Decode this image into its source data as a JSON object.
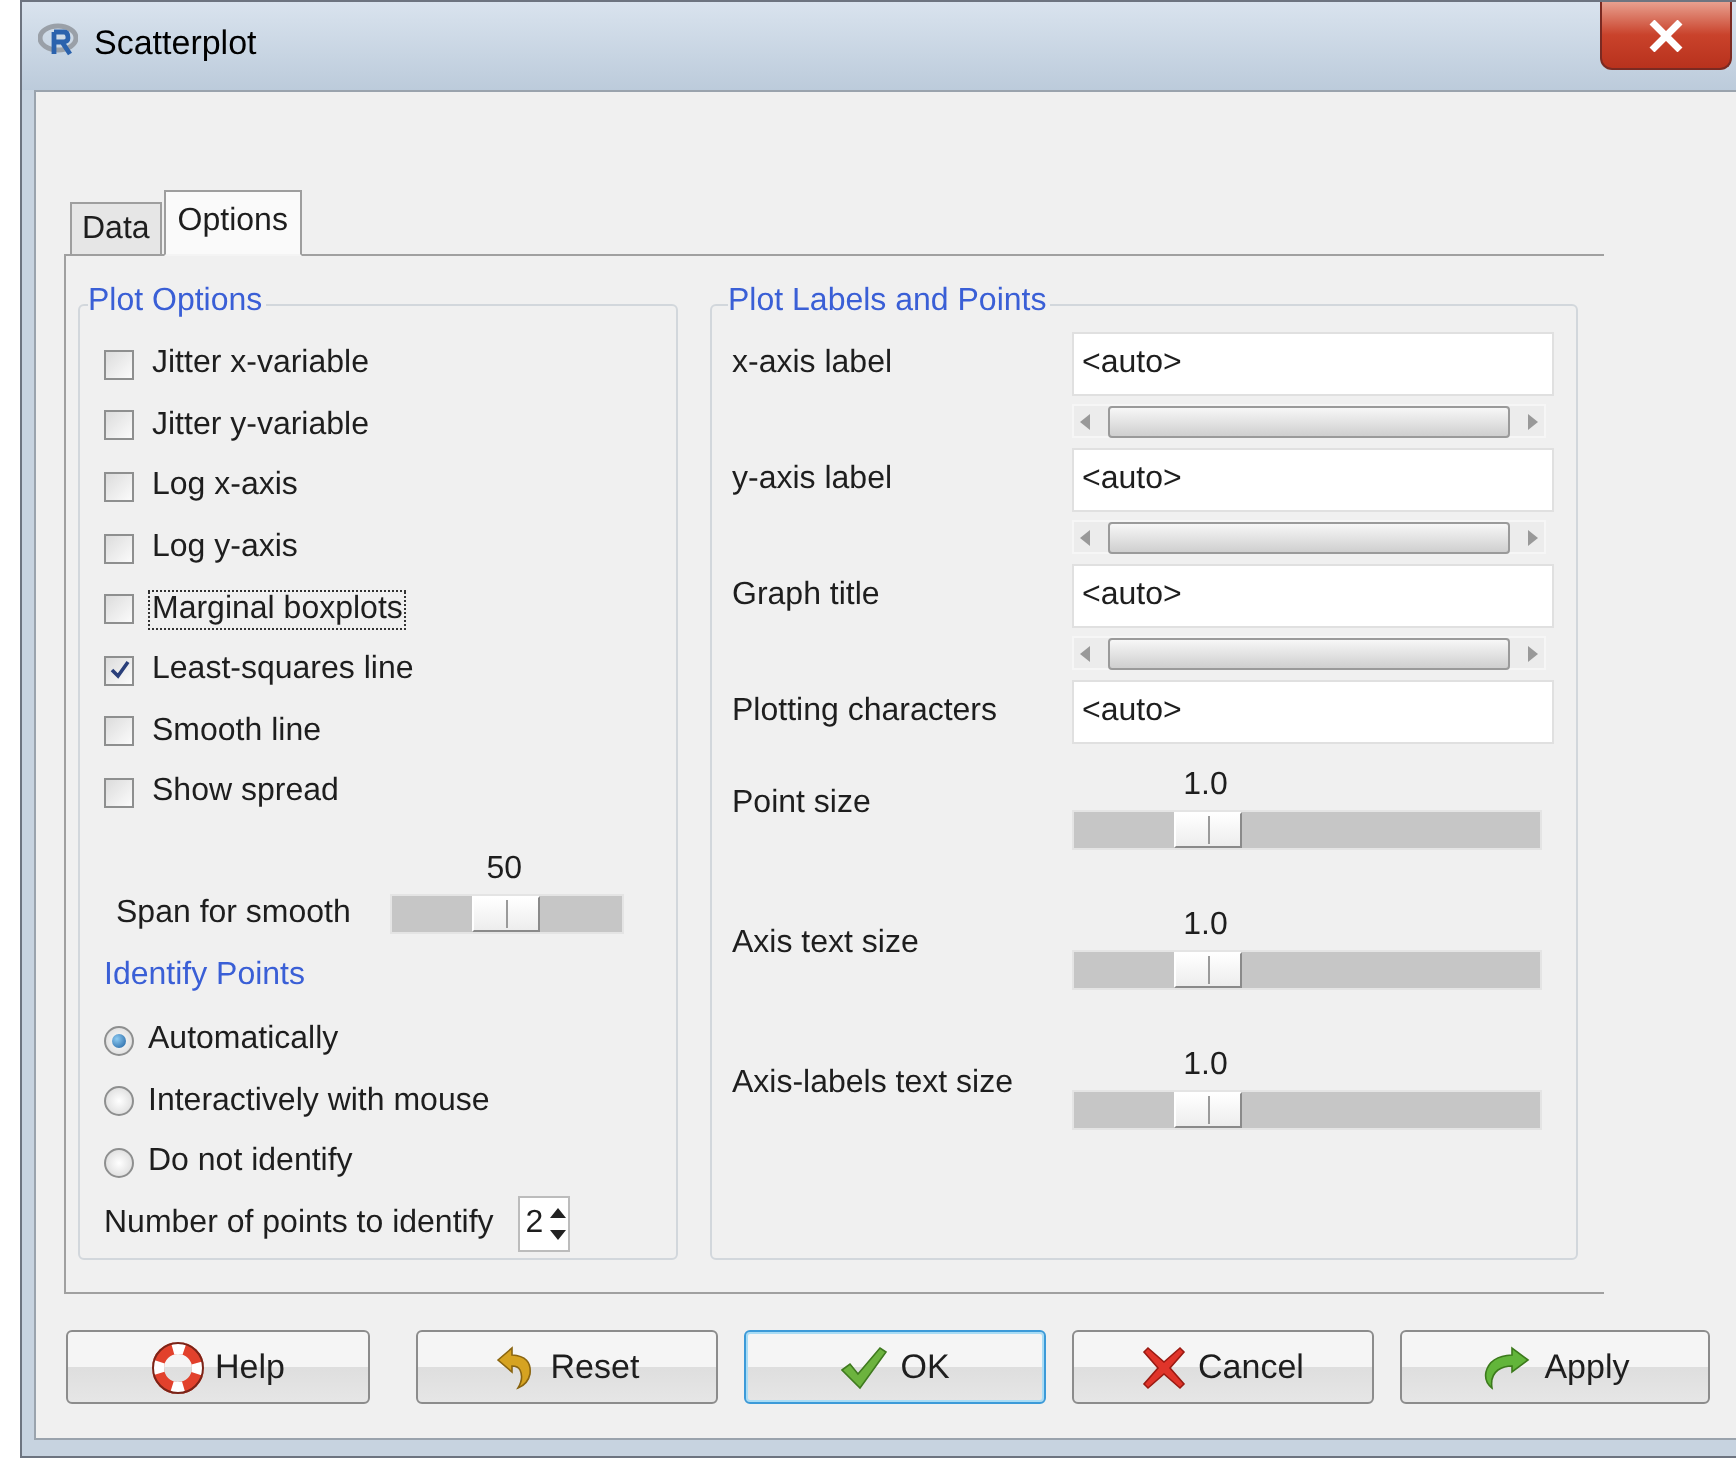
{
  "window": {
    "title": "Scatterplot"
  },
  "tabs": [
    {
      "label": "Data",
      "selected": false
    },
    {
      "label": "Options",
      "selected": true
    }
  ],
  "plot_options": {
    "title": "Plot Options",
    "checkboxes": [
      {
        "label": "Jitter x-variable",
        "checked": false,
        "focused": false
      },
      {
        "label": "Jitter y-variable",
        "checked": false,
        "focused": false
      },
      {
        "label": "Log x-axis",
        "checked": false,
        "focused": false
      },
      {
        "label": "Log y-axis",
        "checked": false,
        "focused": false
      },
      {
        "label": "Marginal boxplots",
        "checked": false,
        "focused": true
      },
      {
        "label": "Least-squares line",
        "checked": true,
        "focused": false
      },
      {
        "label": "Smooth line",
        "checked": false,
        "focused": false
      },
      {
        "label": "Show spread",
        "checked": false,
        "focused": false
      }
    ],
    "span": {
      "label": "Span for smooth",
      "reading": "50",
      "level": 0.49
    }
  },
  "identify": {
    "title": "Identify Points",
    "options": [
      {
        "label": "Automatically",
        "selected": true
      },
      {
        "label": "Interactively with mouse",
        "selected": false
      },
      {
        "label": "Do not identify",
        "selected": false
      }
    ],
    "count": {
      "label": "Number of points to identify",
      "value": "2"
    }
  },
  "labels_points": {
    "title": "Plot Labels and Points",
    "fields": [
      {
        "label": "x-axis label",
        "value": "<auto>",
        "scrollbar": true
      },
      {
        "label": "y-axis label",
        "value": "<auto>",
        "scrollbar": true
      },
      {
        "label": "Graph title",
        "value": "<auto>",
        "scrollbar": true
      },
      {
        "label": "Plotting characters",
        "value": "<auto>",
        "scrollbar": false
      }
    ],
    "sliders": [
      {
        "label": "Point size",
        "reading": "1.0",
        "level": 0.25
      },
      {
        "label": "Axis text size",
        "reading": "1.0",
        "level": 0.25
      },
      {
        "label": "Axis-labels text size",
        "reading": "1.0",
        "level": 0.25
      }
    ]
  },
  "buttons": [
    {
      "label": "Help",
      "kind": "help",
      "focused": false
    },
    {
      "label": "Reset",
      "kind": "reset",
      "focused": false
    },
    {
      "label": "OK",
      "kind": "ok",
      "focused": true
    },
    {
      "label": "Cancel",
      "kind": "cancel",
      "focused": false
    },
    {
      "label": "Apply",
      "kind": "apply",
      "focused": false
    }
  ]
}
